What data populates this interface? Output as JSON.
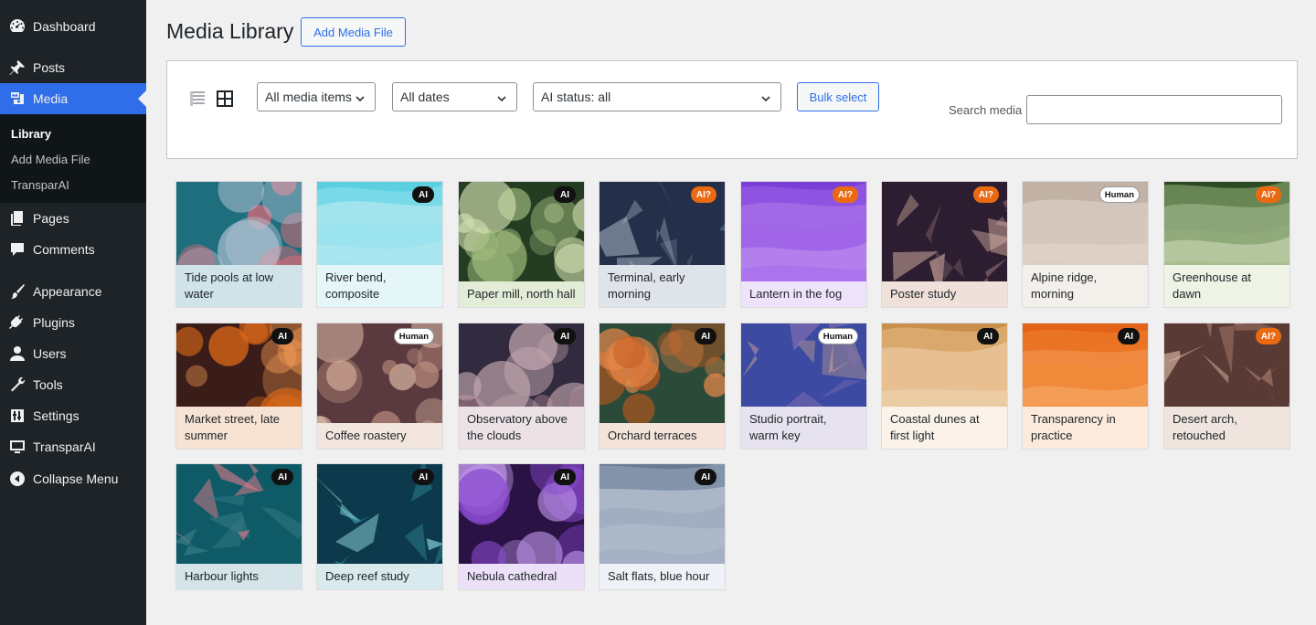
{
  "sidebar": {
    "items": [
      {
        "label": "Dashboard",
        "icon": "dashboard-icon"
      },
      {
        "label": "Posts",
        "icon": "pushpin-icon"
      },
      {
        "label": "Media",
        "icon": "media-icon",
        "active": true
      },
      {
        "label": "Pages",
        "icon": "pages-icon"
      },
      {
        "label": "Comments",
        "icon": "comment-icon"
      },
      {
        "label": "Appearance",
        "icon": "brush-icon"
      },
      {
        "label": "Plugins",
        "icon": "plug-icon"
      },
      {
        "label": "Users",
        "icon": "user-icon"
      },
      {
        "label": "Tools",
        "icon": "wrench-icon"
      },
      {
        "label": "Settings",
        "icon": "sliders-icon"
      },
      {
        "label": "TransparAI",
        "icon": "monitor-icon"
      },
      {
        "label": "Collapse Menu",
        "icon": "collapse-icon"
      }
    ],
    "submenu": [
      {
        "label": "Library",
        "current": true
      },
      {
        "label": "Add Media File"
      },
      {
        "label": "TransparAI"
      }
    ]
  },
  "header": {
    "title": "Media Library",
    "add_button": "Add Media File"
  },
  "toolbar": {
    "filter_type": "All media items",
    "filter_date": "All dates",
    "filter_ai": "AI status: all",
    "bulk_select": "Bulk select",
    "search_label": "Search media",
    "search_value": ""
  },
  "accent": "#2f6ee8",
  "media": [
    {
      "title": "Tide pools at low water",
      "badge": "",
      "style": "circles",
      "colors": [
        "#1f6e7e",
        "#e86a78",
        "#b6c6d6"
      ],
      "caption_bg": "#d0e3e8"
    },
    {
      "title": "River bend, composite",
      "badge": "AI",
      "style": "waves",
      "colors": [
        "#5cd0e0",
        "#8fe2ee",
        "#c9eef3"
      ],
      "caption_bg": "#e5f6f9"
    },
    {
      "title": "Paper mill, north hall",
      "badge": "AI",
      "style": "circles",
      "colors": [
        "#243d22",
        "#9fba7c",
        "#cfdcae"
      ],
      "caption_bg": "#e3ecd6"
    },
    {
      "title": "Terminal, early morning",
      "badge": "AI?",
      "style": "polys",
      "colors": [
        "#24304a",
        "#5a6a82",
        "#aeb7c6"
      ],
      "caption_bg": "#dfe3ea"
    },
    {
      "title": "Lantern in the fog",
      "badge": "AI?",
      "style": "waves",
      "colors": [
        "#7a3fd6",
        "#a063ea",
        "#cfa5f5"
      ],
      "caption_bg": "#efe3fb"
    },
    {
      "title": "Poster study",
      "badge": "AI?",
      "style": "polys",
      "colors": [
        "#2c1e30",
        "#8a6a72",
        "#e0b8a8"
      ],
      "caption_bg": "#efe0da"
    },
    {
      "title": "Alpine ridge, morning",
      "badge": "Human",
      "style": "waves",
      "colors": [
        "#b8a89a",
        "#d6c8bc",
        "#ece4dc"
      ],
      "caption_bg": "#f3efea"
    },
    {
      "title": "Greenhouse at dawn",
      "badge": "AI?",
      "style": "waves",
      "colors": [
        "#2e4a24",
        "#9ab87e",
        "#d6e2c2"
      ],
      "caption_bg": "#eef3e6"
    },
    {
      "title": "Market street, late summer",
      "badge": "AI",
      "style": "circles",
      "colors": [
        "#3a1c18",
        "#e06a18",
        "#f29a52"
      ],
      "caption_bg": "#f7e3d4"
    },
    {
      "title": "Coffee roastery",
      "badge": "Human",
      "style": "circles",
      "colors": [
        "#5a3a3e",
        "#c29282",
        "#e8c4b0"
      ],
      "caption_bg": "#f3e6df"
    },
    {
      "title": "Observatory above the clouds",
      "badge": "AI",
      "style": "circles",
      "colors": [
        "#322a3e",
        "#8a6a7a",
        "#c4a8b0"
      ],
      "caption_bg": "#ece2e6"
    },
    {
      "title": "Orchard terraces",
      "badge": "AI",
      "style": "circles",
      "colors": [
        "#2c4a3a",
        "#c2581c",
        "#e8884a"
      ],
      "caption_bg": "#f3e3d8"
    },
    {
      "title": "Studio portrait, warm key",
      "badge": "Human",
      "style": "polys",
      "colors": [
        "#3c4aa2",
        "#8a72b2",
        "#d2a890"
      ],
      "caption_bg": "#e6e2ef"
    },
    {
      "title": "Coastal dunes at first light",
      "badge": "AI",
      "style": "waves",
      "colors": [
        "#c8904a",
        "#e8bc88",
        "#f6e0c6"
      ],
      "caption_bg": "#fbf3ea"
    },
    {
      "title": "Transparency in practice",
      "badge": "AI",
      "style": "waves",
      "colors": [
        "#e26218",
        "#f48a34",
        "#f8b070"
      ],
      "caption_bg": "#fcebdc"
    },
    {
      "title": "Desert arch, retouched",
      "badge": "AI?",
      "style": "polys",
      "colors": [
        "#5a3a34",
        "#a4786a",
        "#d8b4a2"
      ],
      "caption_bg": "#efe4de"
    },
    {
      "title": "Harbour lights",
      "badge": "AI",
      "style": "polys",
      "colors": [
        "#0e5a66",
        "#3a7e8a",
        "#e07a8a"
      ],
      "caption_bg": "#d4e4e8"
    },
    {
      "title": "Deep reef study",
      "badge": "AI",
      "style": "polys",
      "colors": [
        "#0c3a4c",
        "#3a9aa8",
        "#8cd2d8"
      ],
      "caption_bg": "#d8eaee"
    },
    {
      "title": "Nebula cathedral",
      "badge": "AI",
      "style": "circles",
      "colors": [
        "#2a1244",
        "#8a4ad0",
        "#c098ec"
      ],
      "caption_bg": "#ece0f8"
    },
    {
      "title": "Salt flats, blue hour",
      "badge": "AI",
      "style": "waves",
      "colors": [
        "#6a7a94",
        "#9aa8bc",
        "#ccd4de"
      ],
      "caption_bg": "#eef1f5"
    }
  ]
}
